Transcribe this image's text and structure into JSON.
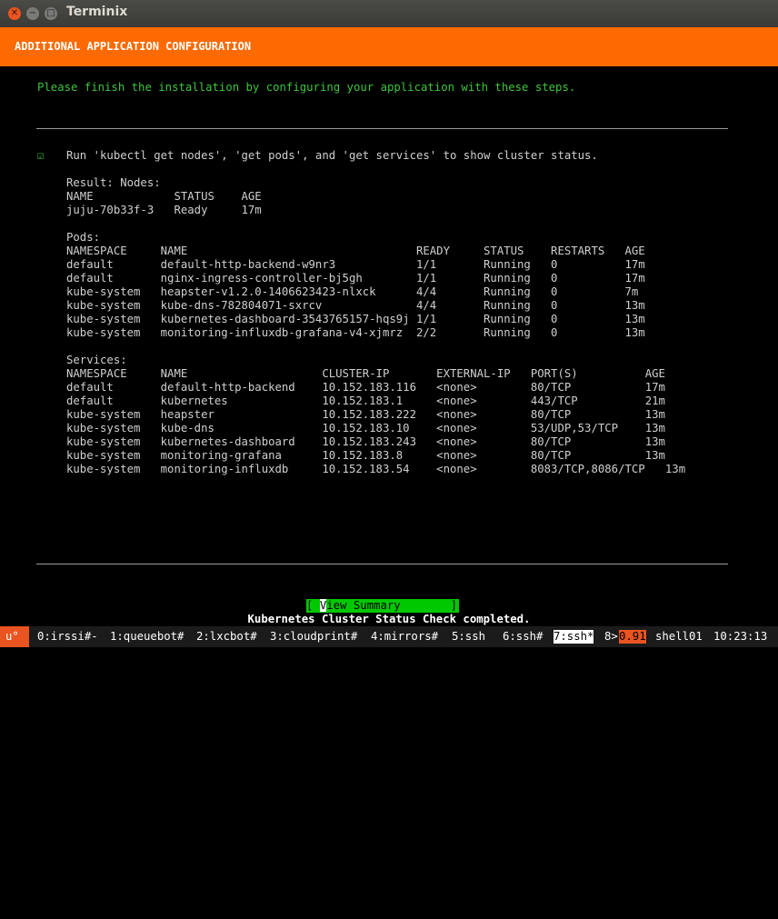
{
  "window": {
    "title": "Terminix",
    "close_glyph": "✕",
    "min_glyph": "−",
    "max_glyph": "□"
  },
  "banner": {
    "title": "ADDITIONAL APPLICATION CONFIGURATION"
  },
  "intro": "Please finish the installation by configuring your application with these steps.",
  "step": {
    "checkbox": "☑",
    "text": "Run 'kubectl get nodes', 'get pods', and 'get services' to show cluster status."
  },
  "result_lines": [
    "Result: Nodes:",
    "NAME            STATUS    AGE",
    "juju-70b33f-3   Ready     17m",
    "",
    "Pods:",
    "NAMESPACE     NAME                                  READY     STATUS    RESTARTS   AGE",
    "default       default-http-backend-w9nr3            1/1       Running   0          17m",
    "default       nginx-ingress-controller-bj5gh        1/1       Running   0          17m",
    "kube-system   heapster-v1.2.0-1406623423-nlxck      4/4       Running   0          7m",
    "kube-system   kube-dns-782804071-sxrcv              4/4       Running   0          13m",
    "kube-system   kubernetes-dashboard-3543765157-hqs9j 1/1       Running   0          13m",
    "kube-system   monitoring-influxdb-grafana-v4-xjmrz  2/2       Running   0          13m",
    "",
    "Services:",
    "NAMESPACE     NAME                    CLUSTER-IP       EXTERNAL-IP   PORT(S)          AGE",
    "default       default-http-backend    10.152.183.116   <none>        80/TCP           17m",
    "default       kubernetes              10.152.183.1     <none>        443/TCP          21m",
    "kube-system   heapster                10.152.183.222   <none>        80/TCP           13m",
    "kube-system   kube-dns                10.152.183.10    <none>        53/UDP,53/TCP    13m",
    "kube-system   kubernetes-dashboard    10.152.183.243   <none>        80/TCP           13m",
    "kube-system   monitoring-grafana      10.152.183.8     <none>        80/TCP           13m",
    "kube-system   monitoring-influxdb     10.152.183.54    <none>        8083/TCP,8086/TCP   13m"
  ],
  "summary_button": {
    "open": "[ ",
    "cursor_char": "V",
    "rest": "iew Summary",
    "close": "]"
  },
  "status_message": "Kubernetes Cluster Status Check completed.",
  "statusbar": {
    "session": "u°",
    "windows": [
      "0:irssi#-",
      "1:queuebot#",
      "2:lxcbot#",
      "3:cloudprint#",
      "4:mirrors#",
      "5:ssh",
      "6:ssh#"
    ],
    "current_window": "7:ssh*",
    "next_window": "8>",
    "load": "0.91",
    "host": "shell01",
    "time": "10:23:13"
  }
}
